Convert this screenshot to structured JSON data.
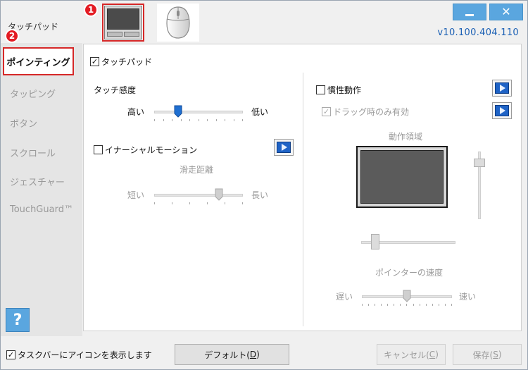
{
  "window": {
    "title": "タッチパッド",
    "version": "v10.100.404.110",
    "minimize_icon": "minimize-icon",
    "close_icon": "close-icon"
  },
  "devices": [
    {
      "name": "touchpad",
      "icon": "touchpad-icon",
      "selected": true
    },
    {
      "name": "mouse",
      "icon": "mouse-icon",
      "selected": false
    }
  ],
  "annotations": {
    "badge1": "1",
    "badge2": "2"
  },
  "sidebar": {
    "items": [
      {
        "label": "ポインティング",
        "active": true
      },
      {
        "label": "タッピング"
      },
      {
        "label": "ボタン"
      },
      {
        "label": "スクロール"
      },
      {
        "label": "ジェスチャー"
      },
      {
        "label": "TouchGuard™"
      }
    ],
    "help_label": "?"
  },
  "main": {
    "touchpad_checkbox": {
      "label": "タッチパッド",
      "checked": true
    },
    "sensitivity": {
      "title": "タッチ感度",
      "left": "高い",
      "right": "低い",
      "level": 0.27
    },
    "inertial_motion": {
      "label": "イナーシャルモーション",
      "checked": false
    },
    "glide": {
      "title": "滑走距離",
      "left": "短い",
      "right": "長い",
      "level": 0.7
    },
    "inertia": {
      "label": "慣性動作",
      "checked": false
    },
    "drag_only": {
      "label": "ドラッグ時のみ有効",
      "checked": true,
      "disabled": true
    },
    "motion_area": {
      "title": "動作領域",
      "v_level": 0.15,
      "h_level": 0.15
    },
    "pointer_speed": {
      "title": "ポインターの速度",
      "left": "遅い",
      "right": "速い",
      "level": 0.5
    }
  },
  "bottom": {
    "taskbar_checkbox": {
      "label": "タスクバーにアイコンを表示します",
      "checked": true
    },
    "default_button": {
      "label": "デフォルト(",
      "key": "D",
      "end": ")"
    },
    "cancel_button": {
      "label": "キャンセル(",
      "key": "C",
      "end": ")"
    },
    "save_button": {
      "label": "保存(",
      "key": "S",
      "end": ")"
    }
  },
  "colors": {
    "accent": "#5aa6df",
    "highlight": "#d62828",
    "version": "#1a5fb4"
  }
}
